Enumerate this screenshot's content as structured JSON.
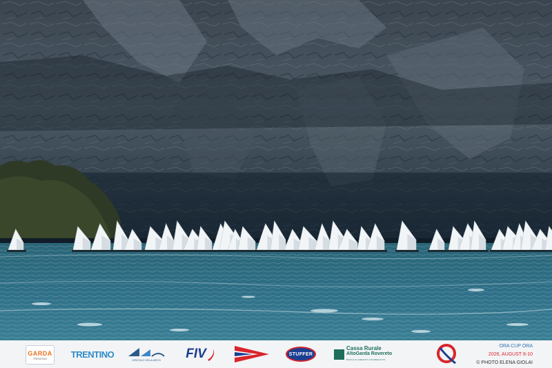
{
  "scene": {
    "subject": "sailing regatta",
    "colors": {
      "cliff_dark": "#1a2a38",
      "cliff_light": "#5f6e7a",
      "lake": "#2f6f85",
      "sail": "#f4f6f8"
    }
  },
  "footer": {
    "logos": [
      {
        "name": "garda-trentino-logo",
        "text": "GARDA",
        "sub": "TRENTINO"
      },
      {
        "name": "trentino-logo",
        "text": "TRENTINO"
      },
      {
        "name": "circolo-vela-logo",
        "sub": "CIRCOLO VELA ARCO"
      },
      {
        "name": "fiv-logo",
        "text": "FIV"
      },
      {
        "name": "flag-logo"
      },
      {
        "name": "stuffer-logo",
        "text": "STUFFER"
      },
      {
        "name": "cassa-rurale-logo",
        "line1": "Cassa Rurale",
        "line2": "AltoGarda Rovereto",
        "line3": "BANCA DI CREDITO COOPERATIVO"
      },
      {
        "name": "ora-q-logo"
      }
    ],
    "event": {
      "name": "ORA CUP ORA",
      "date": "2026, AUGUST 8-10",
      "credit": "© PHOTO ELENA GIOLAI"
    }
  }
}
